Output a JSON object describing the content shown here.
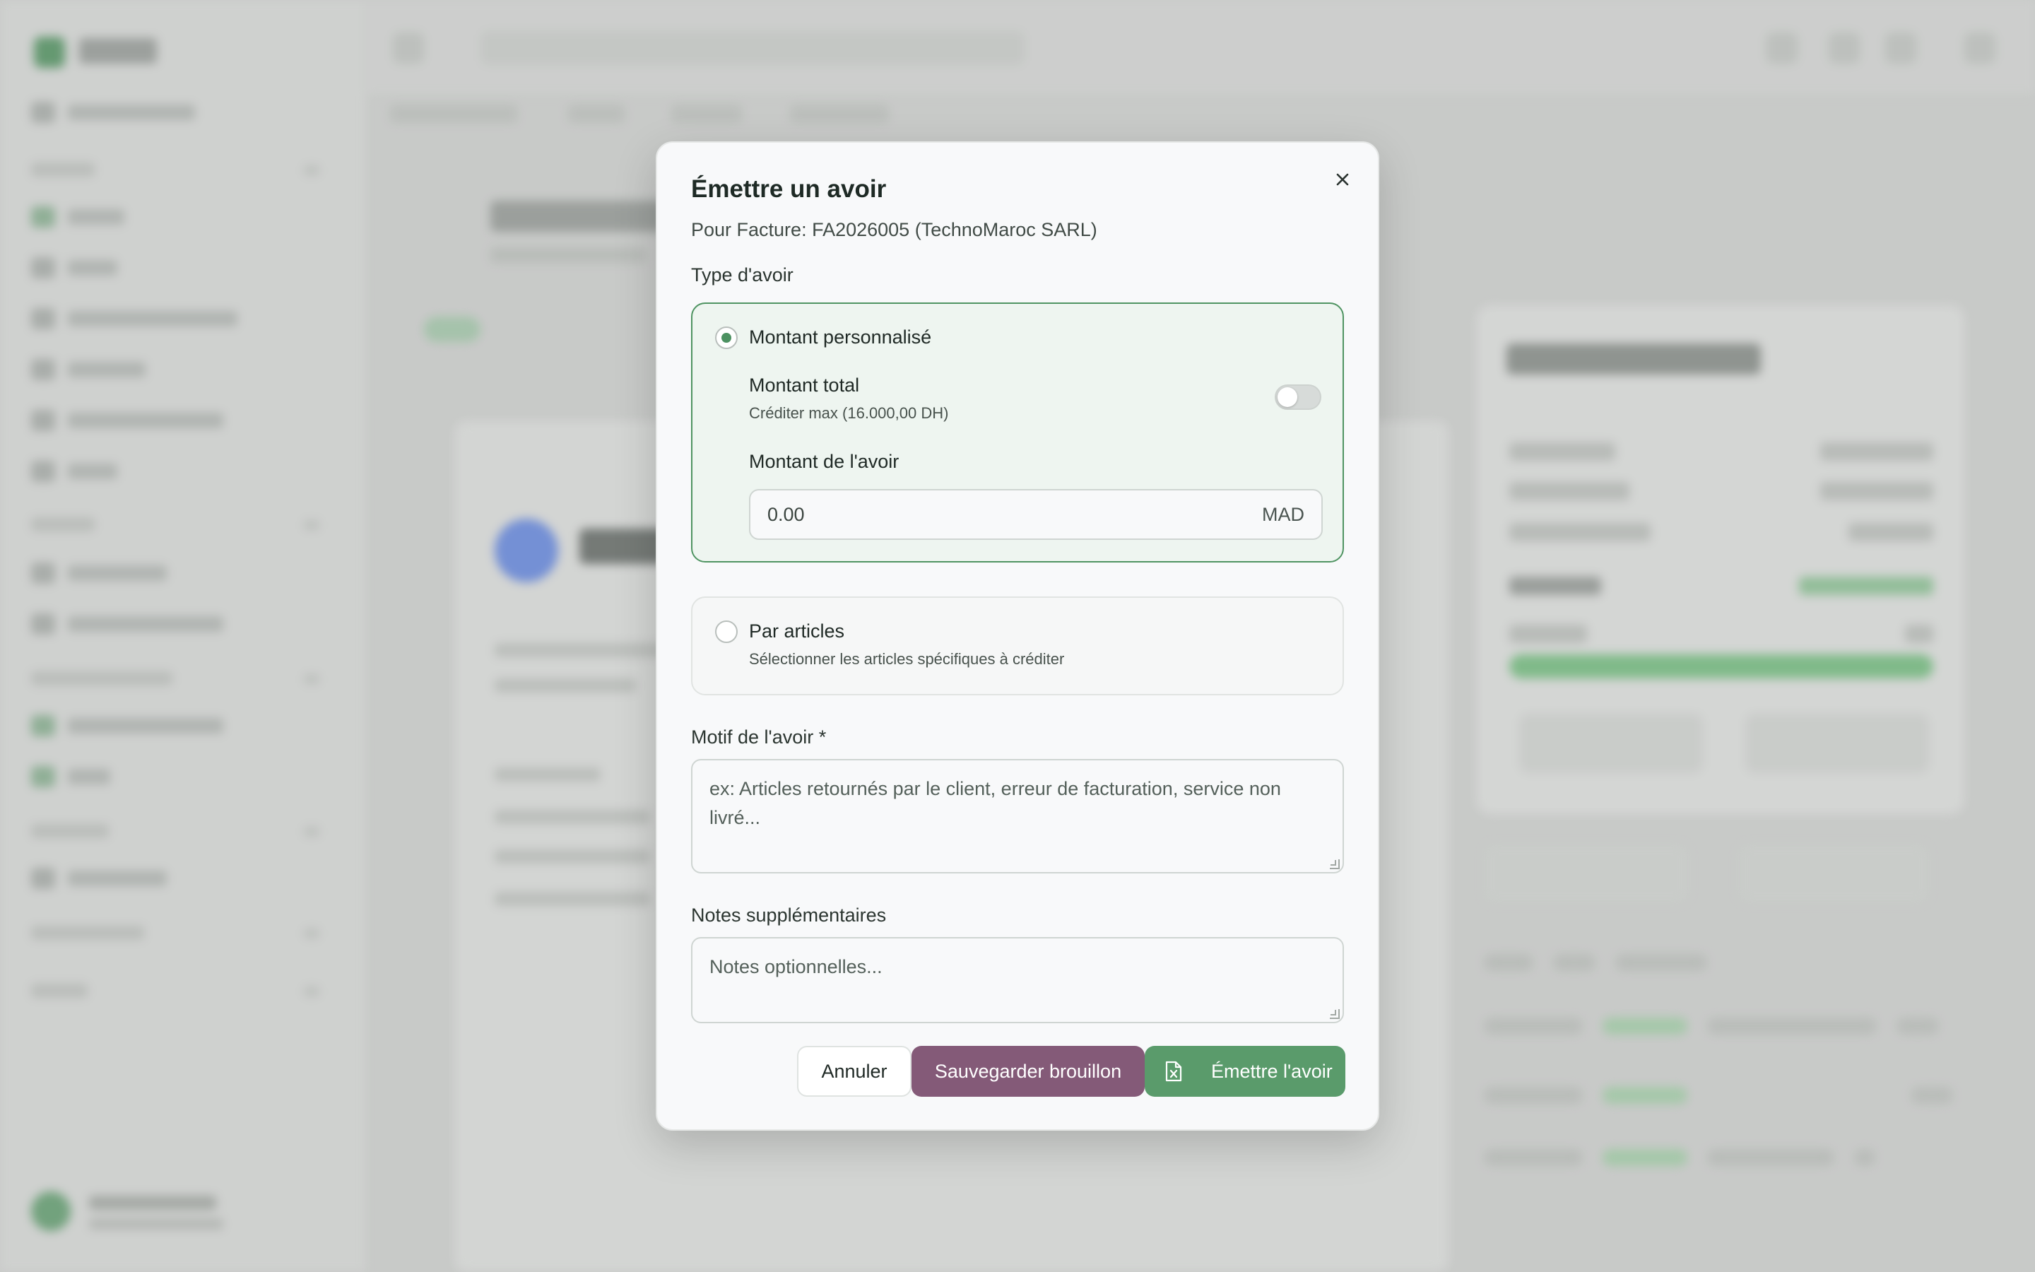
{
  "modal": {
    "title": "Émettre un avoir",
    "subtitle": "Pour Facture: FA2026005 (TechnoMaroc SARL)",
    "close_icon": "close-icon",
    "type_label": "Type d'avoir",
    "option_custom": {
      "title": "Montant personnalisé",
      "selected": true,
      "total_label": "Montant total",
      "total_desc": "Créditer max (16.000,00 DH)",
      "total_toggle_on": false,
      "amount_label": "Montant de l'avoir",
      "amount_value": "0.00",
      "currency": "MAD"
    },
    "option_items": {
      "title": "Par articles",
      "desc": "Sélectionner les articles spécifiques à créditer",
      "selected": false
    },
    "reason": {
      "label": "Motif de l'avoir *",
      "placeholder": "ex: Articles retournés par le client, erreur de facturation, service non livré..."
    },
    "notes": {
      "label": "Notes supplémentaires",
      "placeholder": "Notes optionnelles..."
    },
    "buttons": {
      "cancel": "Annuler",
      "draft": "Sauvegarder brouillon",
      "issue": "Émettre l'avoir",
      "issue_icon": "file-excel-icon"
    }
  },
  "colors": {
    "accent_green": "#5a9b6b",
    "draft_purple": "#845a78",
    "selected_border": "#4f9462"
  }
}
